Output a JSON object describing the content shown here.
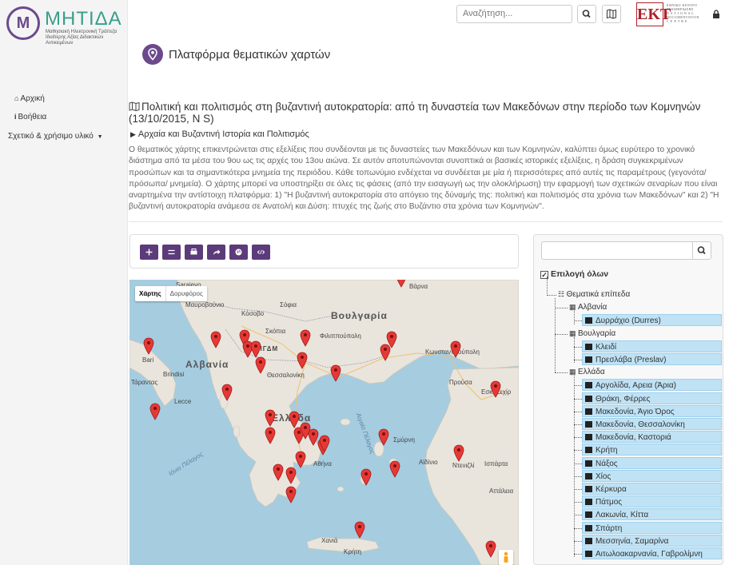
{
  "sidebar": {
    "logo": {
      "mark": "Μ",
      "title": "ΜΗΤΙΔΑ",
      "subtitle": "Μαθησιακή Ηλεκτρονική Τράπεζα Ιδιαίτερης Αξίας Διδακτικών Αντικειμένων"
    },
    "nav": [
      {
        "label": "Αρχική",
        "icon": "home-icon"
      },
      {
        "label": "Βοήθεια",
        "icon": "info-icon"
      },
      {
        "label": "Σχετικό & χρήσιμο υλικό",
        "icon": "caret-down-icon"
      }
    ]
  },
  "topbar": {
    "search_placeholder": "Αναζήτηση...",
    "ekt": {
      "mark": "EKT",
      "text_lines": [
        "ΕΘΝΙΚΟ ΚΕΝΤΡΟ",
        "ΤΕΚΜΗΡΙΩΣΗΣ",
        "N A T I O N A L",
        "DOCUMENTATION",
        "C E N T R E"
      ]
    }
  },
  "platform_title": "Πλατφόρμα θεματικών χαρτών",
  "map_info": {
    "title": "Πολιτική και πολιτισμός στη βυζαντινή αυτοκρατορία: από τη δυναστεία των Μακεδόνων στην περίοδο των Κομνηνών (13/10/2015, N S)",
    "category": "Αρχαία και Βυζαντινή Ιστορία και Πολιτισμός",
    "description": "Ο θεματικός χάρτης επικεντρώνεται στις εξελίξεις που συνδέονται με τις δυναστείες των Μακεδόνων και των Κομνηνών, καλύπτει όμως ευρύτερο το χρονικό διάστημα από τα μέσα του 9ου ως τις αρχές του 13ου αιώνα. Σε αυτόν αποτυπώνονται συνοπτικά οι βασικές ιστορικές εξελίξεις, η δράση συγκεκριμένων προσώπων και τα σημαντικότερα μνημεία της περιόδου. Κάθε τοπωνύμιο ενδέχεται να συνδέεται με μία ή περισσότερες από αυτές τις παραμέτρους (γεγονότα/πρόσωπα/ μνημεία). Ο χάρτης μπορεί να υποστηρίξει σε όλες τις φάσεις (από την εισαγωγή ως την ολοκλήρωση) την εφαρμογή των σχετικών σεναρίων που είναι αναρτημένα την αντίστοιχη πλατφόρμα: 1) \"Η βυζαντινή αυτοκρατορία στο απόγειο της δύναμής της: πολιτική και πολιτισμός στα χρόνια των Μακεδόνων\" και 2) \"Η βυζαντινή αυτοκρατορία ανάμεσα σε Ανατολή και Δύση: πτυχές της ζωής στο Βυζάντιο στα χρόνια των Κομνηνών\"."
  },
  "toolbar": {
    "buttons": [
      {
        "icon": "move-icon"
      },
      {
        "icon": "swap-icon"
      },
      {
        "icon": "print-icon"
      },
      {
        "icon": "share-icon"
      },
      {
        "icon": "globe-icon"
      },
      {
        "icon": "embed-code-icon"
      }
    ]
  },
  "map": {
    "type_map": "Χάρτης",
    "type_satellite": "Δορυφόρος",
    "labels": {
      "albania": "Αλβανία",
      "bulgaria": "Βουλγαρία",
      "greece": "Ελλάδα",
      "sarajevo": "Sarajevo",
      "montenegro": "Μαυροβούνιο",
      "kosovo": "Κόσοβο",
      "sofia": "Σόφια",
      "fyrom": "ΠΓΔΜ",
      "skopje": "Σκόπια",
      "plovdiv": "Φιλιππούπολη",
      "varna": "Βάρνα",
      "istanbul": "Κωνσταντινούπολη",
      "thessaloniki": "Θεσσαλονίκη",
      "bursa": "Προύσα",
      "eskisehir": "Εσκί Σεχίρ",
      "smyrna": "Σμύρνη",
      "aydin": "Αϊδίνιο",
      "denizli": "Ντενιζλί",
      "isparta": "Ισπάρτα",
      "antalya": "Αττάλεια",
      "crete": "Κρήτη",
      "chania": "Χανιά",
      "athens": "Αθήνα",
      "brindisi": "Brindisi",
      "taranto": "Τάραντας",
      "lecce": "Lecce",
      "bari": "Bari",
      "ionian_sea": "Ιόνιο Πέλαγος",
      "aegean_sea": "Αιγαίο Πέλαγος"
    }
  },
  "tree": {
    "select_all": "Επιλογή όλων",
    "root": "Θεματικά επίπεδα",
    "groups": [
      {
        "name": "Αλβανία",
        "items": [
          "Δυρράχιο (Durres)"
        ]
      },
      {
        "name": "Βουλγαρία",
        "items": [
          "Κλειδί",
          "Πρεσλάβα (Preslav)"
        ]
      },
      {
        "name": "Ελλάδα",
        "items": [
          "Αργολίδα, Αρεια (Άρια)",
          "Θράκη, Φέρρες",
          "Μακεδονία, Άγιο Όρος",
          "Μακεδονία, Θεσσαλονίκη",
          "Μακεδονία, Καστοριά",
          "Κρήτη",
          "Νάξος",
          "Χίος",
          "Κέρκυρα",
          "Πάτμος",
          "Λακωνία, Κίττα",
          "Σπάρτη",
          "Μεσσηνία, Σαμαρίνα",
          "Αιτωλοακαρνανία, Γαβρολίμνη"
        ]
      }
    ]
  },
  "colors": {
    "brand_purple": "#6b4a8c",
    "brand_teal": "#3a9e8d",
    "toolbar_button": "#5c3b7a",
    "marker_red": "#e53935",
    "tree_leaf_bg": "#bfe2f5",
    "ekt_red": "#b02028"
  }
}
